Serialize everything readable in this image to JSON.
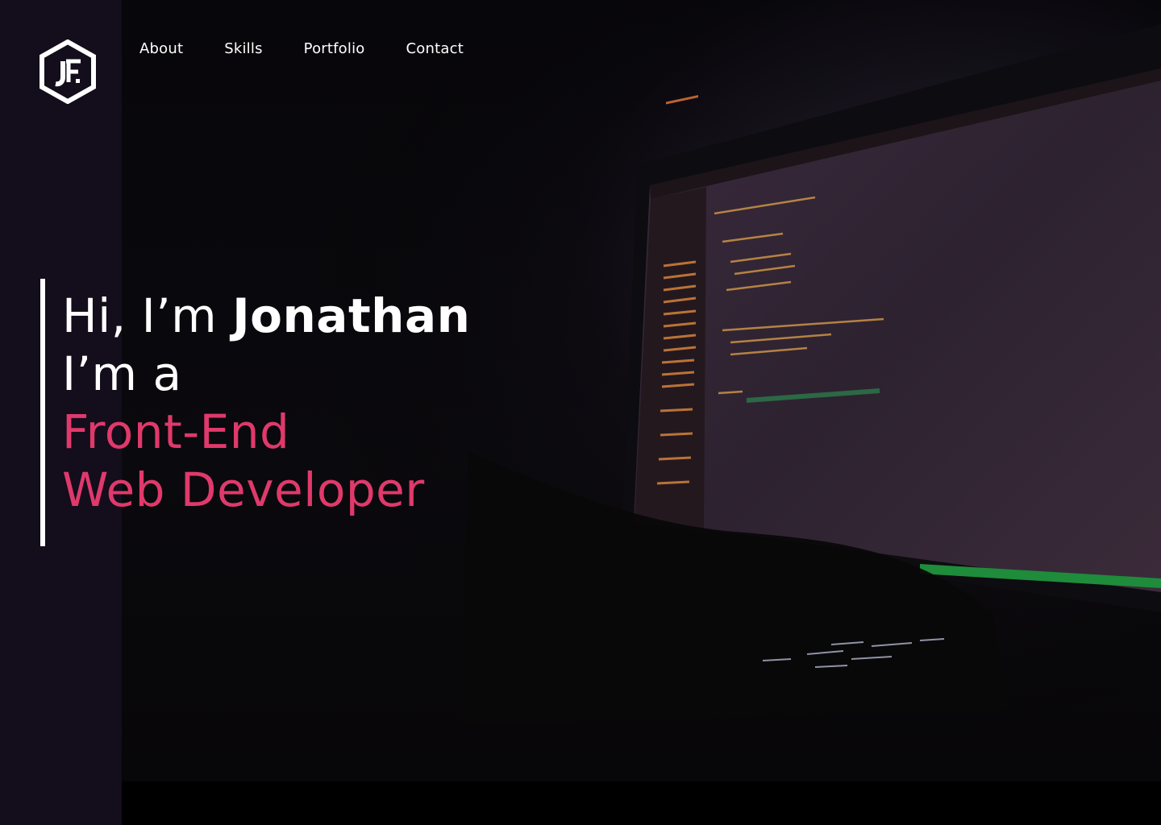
{
  "brand": {
    "logo_text": "JF",
    "colors": {
      "accent": "#e0396c",
      "sidebar": "#140d1b",
      "text": "#ffffff"
    }
  },
  "nav": {
    "items": [
      {
        "label": "About"
      },
      {
        "label": "Skills"
      },
      {
        "label": "Portfolio"
      },
      {
        "label": "Contact"
      }
    ]
  },
  "hero": {
    "greeting": "Hi, I’m",
    "name": "Jonathan",
    "intro": "I’m a",
    "role_line1": "Front-End",
    "role_line2": "Web Developer",
    "background_image": "laptop-with-code-editor-in-dark-room"
  }
}
